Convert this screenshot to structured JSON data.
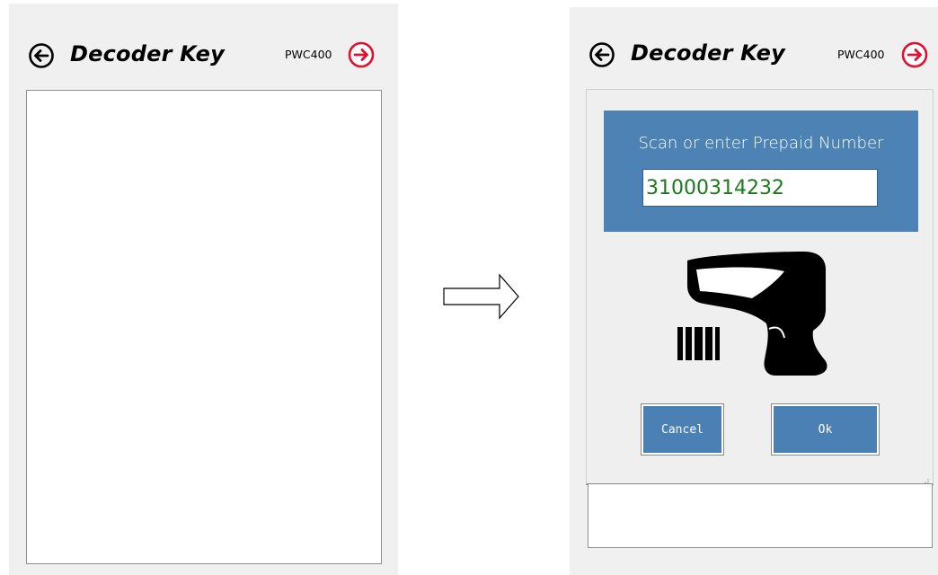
{
  "before": {
    "header": {
      "title": "Decoder Key",
      "device": "PWC400",
      "back_icon": "back-arrow-circle-icon",
      "forward_icon": "forward-arrow-circle-icon"
    }
  },
  "transition": {
    "icon": "right-arrow-icon"
  },
  "after": {
    "header": {
      "title": "Decoder Key",
      "device": "PWC400",
      "back_icon": "back-arrow-circle-icon",
      "forward_icon": "forward-arrow-circle-icon"
    },
    "dialog": {
      "prompt": "Scan or enter Prepaid Number",
      "prepaid_number": "31000314232",
      "illustration_icon": "barcode-scanner-icon",
      "cancel_label": "Cancel",
      "ok_label": "Ok"
    }
  },
  "colors": {
    "panel_bg": "#f0f0f0",
    "scan_box_bg": "#4c83b4",
    "button_bg": "#4a80b3",
    "input_text": "#1c7a1c",
    "forward_icon": "#e0102e"
  }
}
